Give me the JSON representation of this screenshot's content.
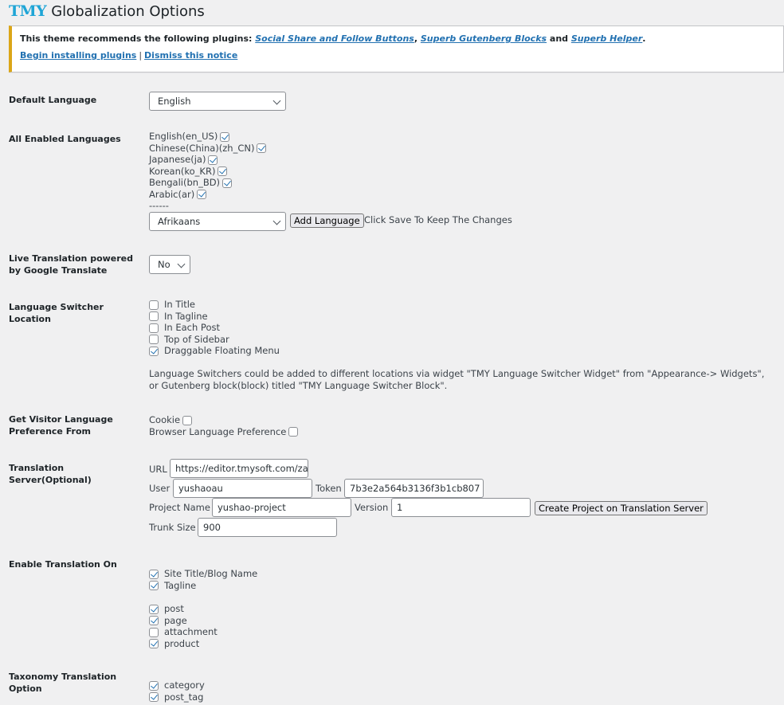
{
  "header": {
    "logo": "TMY",
    "title": "Globalization Options"
  },
  "notice": {
    "prefix": "This theme recommends the following plugins: ",
    "plugins": [
      "Social Share and Follow Buttons",
      "Superb Gutenberg Blocks",
      "Superb Helper"
    ],
    "sep1": ", ",
    "and": " and ",
    "suffix": ".",
    "begin_link": "Begin installing plugins",
    "pipe": "|",
    "dismiss_link": "Dismiss this notice"
  },
  "default_language": {
    "label": "Default Language",
    "value": "English"
  },
  "enabled_languages": {
    "label": "All Enabled Languages",
    "items": [
      {
        "name": "English(en_US)",
        "checked": true
      },
      {
        "name": "Chinese(China)(zh_CN)",
        "checked": true
      },
      {
        "name": "Japanese(ja)",
        "checked": true
      },
      {
        "name": "Korean(ko_KR)",
        "checked": true
      },
      {
        "name": "Bengali(bn_BD)",
        "checked": true
      },
      {
        "name": "Arabic(ar)",
        "checked": true
      }
    ],
    "divider": "------",
    "add_select_value": "Afrikaans",
    "add_button": "Add Language",
    "hint": "Click Save To Keep The Changes"
  },
  "live_translation": {
    "label": "Live Translation powered by Google Translate",
    "value": "No"
  },
  "switcher_location": {
    "label": "Language Switcher Location",
    "options": [
      {
        "name": "In Title",
        "checked": false
      },
      {
        "name": "In Tagline",
        "checked": false
      },
      {
        "name": "In Each Post",
        "checked": false
      },
      {
        "name": "Top of Sidebar",
        "checked": false
      },
      {
        "name": "Draggable Floating Menu",
        "checked": true
      }
    ],
    "description_line1": "Language Switchers could be added to different locations via widget \"TMY Language Switcher Widget\" from \"Appearance-> Widgets\",",
    "description_line2": "or Gutenberg block(block) titled \"TMY Language Switcher Block\"."
  },
  "visitor_preference": {
    "label": "Get Visitor Language Preference From",
    "options": [
      {
        "name": "Cookie",
        "checked": false
      },
      {
        "name": "Browser Language Preference",
        "checked": false
      }
    ]
  },
  "translation_server": {
    "label": "Translation Server(Optional)",
    "url_label": "URL",
    "url_value": "https://editor.tmysoft.com/za",
    "user_label": "User",
    "user_value": "yushaoau",
    "token_label": "Token",
    "token_value": "7b3e2a564b3136f3b1cb807",
    "project_label": "Project Name",
    "project_value": "yushao-project",
    "version_label": "Version",
    "version_value": "1",
    "create_button": "Create Project on Translation Server",
    "trunk_label": "Trunk Size",
    "trunk_value": "900"
  },
  "enable_translation": {
    "label": "Enable Translation On",
    "site_items": [
      {
        "name": "Site Title/Blog Name",
        "checked": true
      },
      {
        "name": "Tagline",
        "checked": true
      }
    ],
    "post_types": [
      {
        "name": "post",
        "checked": true
      },
      {
        "name": "page",
        "checked": true
      },
      {
        "name": "attachment",
        "checked": false
      },
      {
        "name": "product",
        "checked": true
      }
    ]
  },
  "taxonomy": {
    "label": "Taxonomy Translation Option",
    "items": [
      {
        "name": "category",
        "checked": true
      },
      {
        "name": "post_tag",
        "checked": true
      }
    ]
  }
}
